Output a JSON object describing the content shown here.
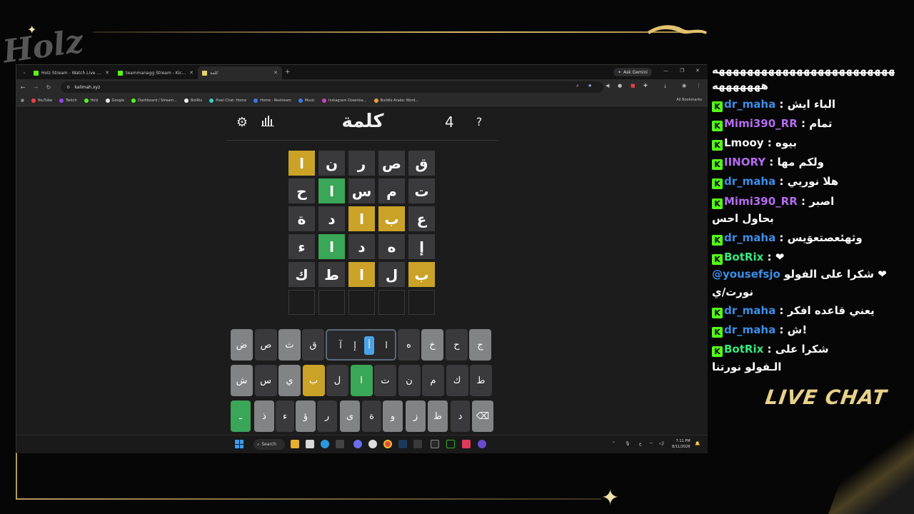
{
  "browser": {
    "tabs": [
      {
        "label": "Holz Stream - Watch Live on Kick",
        "color": "#53fc18",
        "active": false
      },
      {
        "label": "teammanagg Stream - Kick Dashboard",
        "color": "#53fc18",
        "active": false
      },
      {
        "label": "كلمة",
        "color": "#e6d36a",
        "active": true
      }
    ],
    "new_tab": "+",
    "ask_gemini": "Ask Gemini",
    "url": "kalimah.xyz",
    "bookmarks": [
      {
        "label": "YouTube",
        "color": "#ff3d3d"
      },
      {
        "label": "Twitch",
        "color": "#9146ff"
      },
      {
        "label": "Holz",
        "color": "#53fc18"
      },
      {
        "label": "Google",
        "color": "#e8e8e8"
      },
      {
        "label": "Dashboard / Stream...",
        "color": "#53fc18"
      },
      {
        "label": "BotRix",
        "color": "#f0f0f0"
      },
      {
        "label": "Pixel Chat: Home",
        "color": "#3ad0c0"
      },
      {
        "label": "Home - Restream",
        "color": "#3a7ef0"
      },
      {
        "label": "Music",
        "color": "#3a7ef0"
      },
      {
        "label": "Instagram Downloa...",
        "color": "#d040c0"
      },
      {
        "label": "Buildle Arabic Word...",
        "color": "#f0a030"
      }
    ],
    "all_bookmarks": "All Bookmarks"
  },
  "game": {
    "title": "كلمة",
    "count": "4",
    "board": [
      [
        {
          "l": "ق",
          "s": "absent"
        },
        {
          "l": "ص",
          "s": "absent"
        },
        {
          "l": "ر",
          "s": "absent"
        },
        {
          "l": "ن",
          "s": "absent"
        },
        {
          "l": "ا",
          "s": "present"
        }
      ],
      [
        {
          "l": "ت",
          "s": "absent"
        },
        {
          "l": "م",
          "s": "absent"
        },
        {
          "l": "س",
          "s": "absent"
        },
        {
          "l": "ا",
          "s": "correct"
        },
        {
          "l": "ح",
          "s": "absent"
        }
      ],
      [
        {
          "l": "ع",
          "s": "absent"
        },
        {
          "l": "ب",
          "s": "present"
        },
        {
          "l": "ا",
          "s": "present"
        },
        {
          "l": "د",
          "s": "absent"
        },
        {
          "l": "ة",
          "s": "absent"
        }
      ],
      [
        {
          "l": "إ",
          "s": "absent"
        },
        {
          "l": "ه",
          "s": "absent"
        },
        {
          "l": "د",
          "s": "absent"
        },
        {
          "l": "ا",
          "s": "correct"
        },
        {
          "l": "ء",
          "s": "absent"
        }
      ],
      [
        {
          "l": "ب",
          "s": "present"
        },
        {
          "l": "ل",
          "s": "absent"
        },
        {
          "l": "ا",
          "s": "present"
        },
        {
          "l": "ط",
          "s": "absent"
        },
        {
          "l": "ك",
          "s": "absent"
        }
      ],
      [
        {
          "l": "",
          "s": "empty"
        },
        {
          "l": "",
          "s": "empty"
        },
        {
          "l": "",
          "s": "empty"
        },
        {
          "l": "",
          "s": "empty"
        },
        {
          "l": "",
          "s": "empty"
        }
      ]
    ],
    "keyboard": {
      "row1": [
        {
          "l": "ض",
          "s": "unused"
        },
        {
          "l": "ص",
          "s": "absent"
        },
        {
          "l": "ث",
          "s": "unused"
        },
        {
          "l": "ق",
          "s": "absent"
        },
        {
          "l": "ه",
          "s": "absent"
        },
        {
          "l": "خ",
          "s": "unused"
        },
        {
          "l": "ح",
          "s": "absent"
        },
        {
          "l": "ج",
          "s": "unused"
        }
      ],
      "alif_options": [
        "آ",
        "إ",
        "أ",
        "ا"
      ],
      "row2": [
        {
          "l": "ش",
          "s": "unused"
        },
        {
          "l": "س",
          "s": "absent"
        },
        {
          "l": "ي",
          "s": "unused"
        },
        {
          "l": "ب",
          "s": "present"
        },
        {
          "l": "ل",
          "s": "absent"
        },
        {
          "l": "ا",
          "s": "correct"
        },
        {
          "l": "ت",
          "s": "absent"
        },
        {
          "l": "ن",
          "s": "absent"
        },
        {
          "l": "م",
          "s": "absent"
        },
        {
          "l": "ك",
          "s": "absent"
        },
        {
          "l": "ط",
          "s": "absent"
        }
      ],
      "row3": [
        {
          "l": "ـ",
          "s": "correct"
        },
        {
          "l": "ذ",
          "s": "unused"
        },
        {
          "l": "ء",
          "s": "absent"
        },
        {
          "l": "ؤ",
          "s": "unused"
        },
        {
          "l": "ر",
          "s": "absent"
        },
        {
          "l": "ى",
          "s": "unused"
        },
        {
          "l": "ة",
          "s": "absent"
        },
        {
          "l": "و",
          "s": "unused"
        },
        {
          "l": "ز",
          "s": "unused"
        },
        {
          "l": "ظ",
          "s": "unused"
        },
        {
          "l": "د",
          "s": "absent"
        },
        {
          "l": "⌫",
          "s": "unused"
        }
      ]
    }
  },
  "taskbar": {
    "search": "Search",
    "time": "7:11 PM",
    "date": "8/11/2026",
    "lang": "ع"
  },
  "chat": {
    "messages": [
      {
        "user": "",
        "text": "هههههههههههههههههههههههههههه",
        "color": "u-white"
      },
      {
        "user": "",
        "text": "هههههههه",
        "color": "u-white"
      },
      {
        "user": "dr_maha",
        "text": "الباء ايش",
        "color": "u-blue"
      },
      {
        "user": "Mimi390_RR",
        "text": "تمام",
        "color": "u-purple"
      },
      {
        "user": "Lmooy",
        "text": "بيوه",
        "color": "u-white"
      },
      {
        "user": "IINORY",
        "text": "ولكم مها",
        "color": "u-purple"
      },
      {
        "user": "dr_maha",
        "text": "هلا نوريي",
        "color": "u-blue"
      },
      {
        "user": "Mimi390_RR",
        "text": "اصبر",
        "color": "u-purple"
      },
      {
        "user": "",
        "text": "بحاول احس",
        "color": "u-white"
      },
      {
        "user": "dr_maha",
        "text": "وثهئعصتعوَيس",
        "color": "u-blue"
      },
      {
        "user": "BotRix",
        "text": "❤",
        "color": "u-green"
      },
      {
        "user": "@yousefsjo",
        "text": "شكرا على الفولو ❤",
        "color": "u-blue"
      },
      {
        "user": "",
        "text": "نورت/ي",
        "color": "u-white"
      },
      {
        "user": "dr_maha",
        "text": "يعني قاعده افكر",
        "color": "u-blue"
      },
      {
        "user": "dr_maha",
        "text": "ش!",
        "color": "u-blue"
      },
      {
        "user": "BotRix",
        "text": "شكرا على",
        "color": "u-green"
      },
      {
        "user": "",
        "text": "الـفولو نورتنا",
        "color": "u-white"
      }
    ],
    "live_chat_label": "LIVE CHAT"
  },
  "overlay": {
    "logo_text": "Holz"
  }
}
